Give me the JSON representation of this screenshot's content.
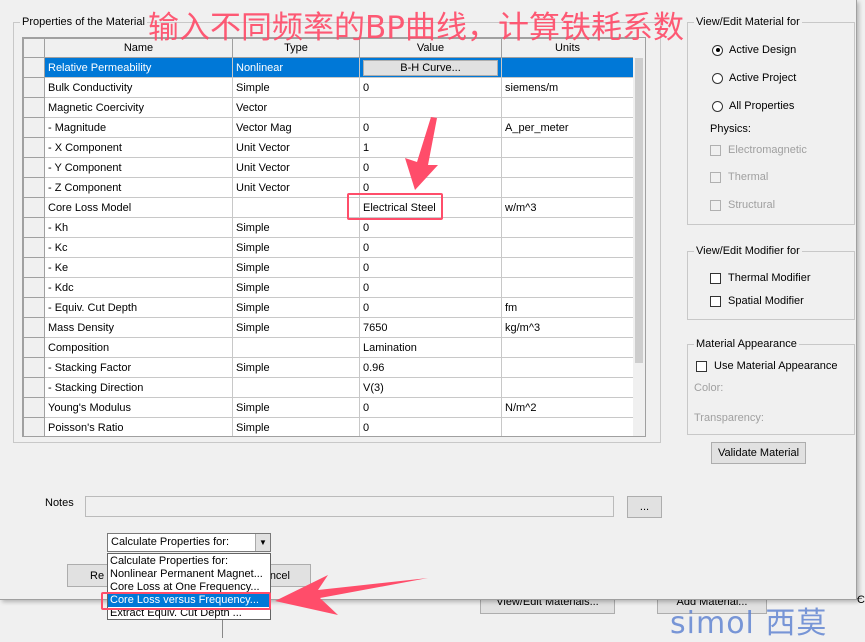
{
  "annotation": {
    "title": "输入不同频率的BP曲线，计算铁耗系数",
    "color": "#ff4d6a"
  },
  "background_window": {
    "buttons": [
      "View/Edit Materials...",
      "Add Material...",
      "C"
    ]
  },
  "properties_group": {
    "label": "Properties of the Material",
    "columns": [
      "Name",
      "Type",
      "Value",
      "Units"
    ],
    "rows": [
      {
        "name": "Relative Permeability",
        "type": "Nonlinear",
        "value": "B-H Curve...",
        "units": "",
        "selected": true,
        "value_is_button": true
      },
      {
        "name": "Bulk Conductivity",
        "type": "Simple",
        "value": "0",
        "units": "siemens/m"
      },
      {
        "name": "Magnetic Coercivity",
        "type": "Vector",
        "value": "",
        "units": ""
      },
      {
        "name": "-  Magnitude",
        "type": "Vector Mag",
        "value": "0",
        "units": "A_per_meter"
      },
      {
        "name": "-  X Component",
        "type": "Unit Vector",
        "value": "1",
        "units": ""
      },
      {
        "name": "-  Y Component",
        "type": "Unit Vector",
        "value": "0",
        "units": ""
      },
      {
        "name": "-  Z Component",
        "type": "Unit Vector",
        "value": "0",
        "units": ""
      },
      {
        "name": "Core Loss Model",
        "type": "",
        "value": "Electrical Steel",
        "units": "w/m^3"
      },
      {
        "name": "-  Kh",
        "type": "Simple",
        "value": "0",
        "units": ""
      },
      {
        "name": "-  Kc",
        "type": "Simple",
        "value": "0",
        "units": ""
      },
      {
        "name": "-  Ke",
        "type": "Simple",
        "value": "0",
        "units": ""
      },
      {
        "name": "-  Kdc",
        "type": "Simple",
        "value": "0",
        "units": ""
      },
      {
        "name": "-  Equiv. Cut Depth",
        "type": "Simple",
        "value": "0",
        "units": "fm"
      },
      {
        "name": "Mass Density",
        "type": "Simple",
        "value": "7650",
        "units": "kg/m^3"
      },
      {
        "name": "Composition",
        "type": "",
        "value": "Lamination",
        "units": ""
      },
      {
        "name": "- Stacking Factor",
        "type": "Simple",
        "value": "0.96",
        "units": ""
      },
      {
        "name": "- Stacking Direction",
        "type": "",
        "value": "V(3)",
        "units": ""
      },
      {
        "name": "Young's Modulus",
        "type": "Simple",
        "value": "0",
        "units": "N/m^2"
      },
      {
        "name": "Poisson's Ratio",
        "type": "Simple",
        "value": "0",
        "units": ""
      }
    ]
  },
  "view_edit_material": {
    "label": "View/Edit Material for",
    "options": [
      {
        "label": "Active Design",
        "checked": true
      },
      {
        "label": "Active Project",
        "checked": false
      },
      {
        "label": "All Properties",
        "checked": false
      }
    ],
    "physics_label": "Physics:",
    "physics": [
      {
        "label": "Electromagnetic",
        "checked": false,
        "disabled": true
      },
      {
        "label": "Thermal",
        "checked": false,
        "disabled": true
      },
      {
        "label": "Structural",
        "checked": false,
        "disabled": true
      }
    ]
  },
  "view_edit_modifier": {
    "label": "View/Edit Modifier for",
    "options": [
      {
        "label": "Thermal Modifier",
        "checked": false
      },
      {
        "label": "Spatial Modifier",
        "checked": false
      }
    ]
  },
  "appearance": {
    "label": "Material Appearance",
    "use_label": "Use Material Appearance",
    "checked": false,
    "color_label": "Color:",
    "transparency_label": "Transparency:"
  },
  "validate_button": "Validate Material",
  "notes": {
    "label": "Notes",
    "value": "",
    "browse": "..."
  },
  "calc_dropdown": {
    "selected": "Calculate Properties for:",
    "options": [
      "Calculate Properties for:",
      "Nonlinear Permanent Magnet...",
      "Core Loss at One Frequency...",
      "Core Loss versus Frequency...",
      "Extract Equiv. Cut Depth ..."
    ],
    "highlighted": 3
  },
  "hidden_buttons": {
    "left": "Re",
    "right": "ncel"
  },
  "watermark": "simol 西莫"
}
